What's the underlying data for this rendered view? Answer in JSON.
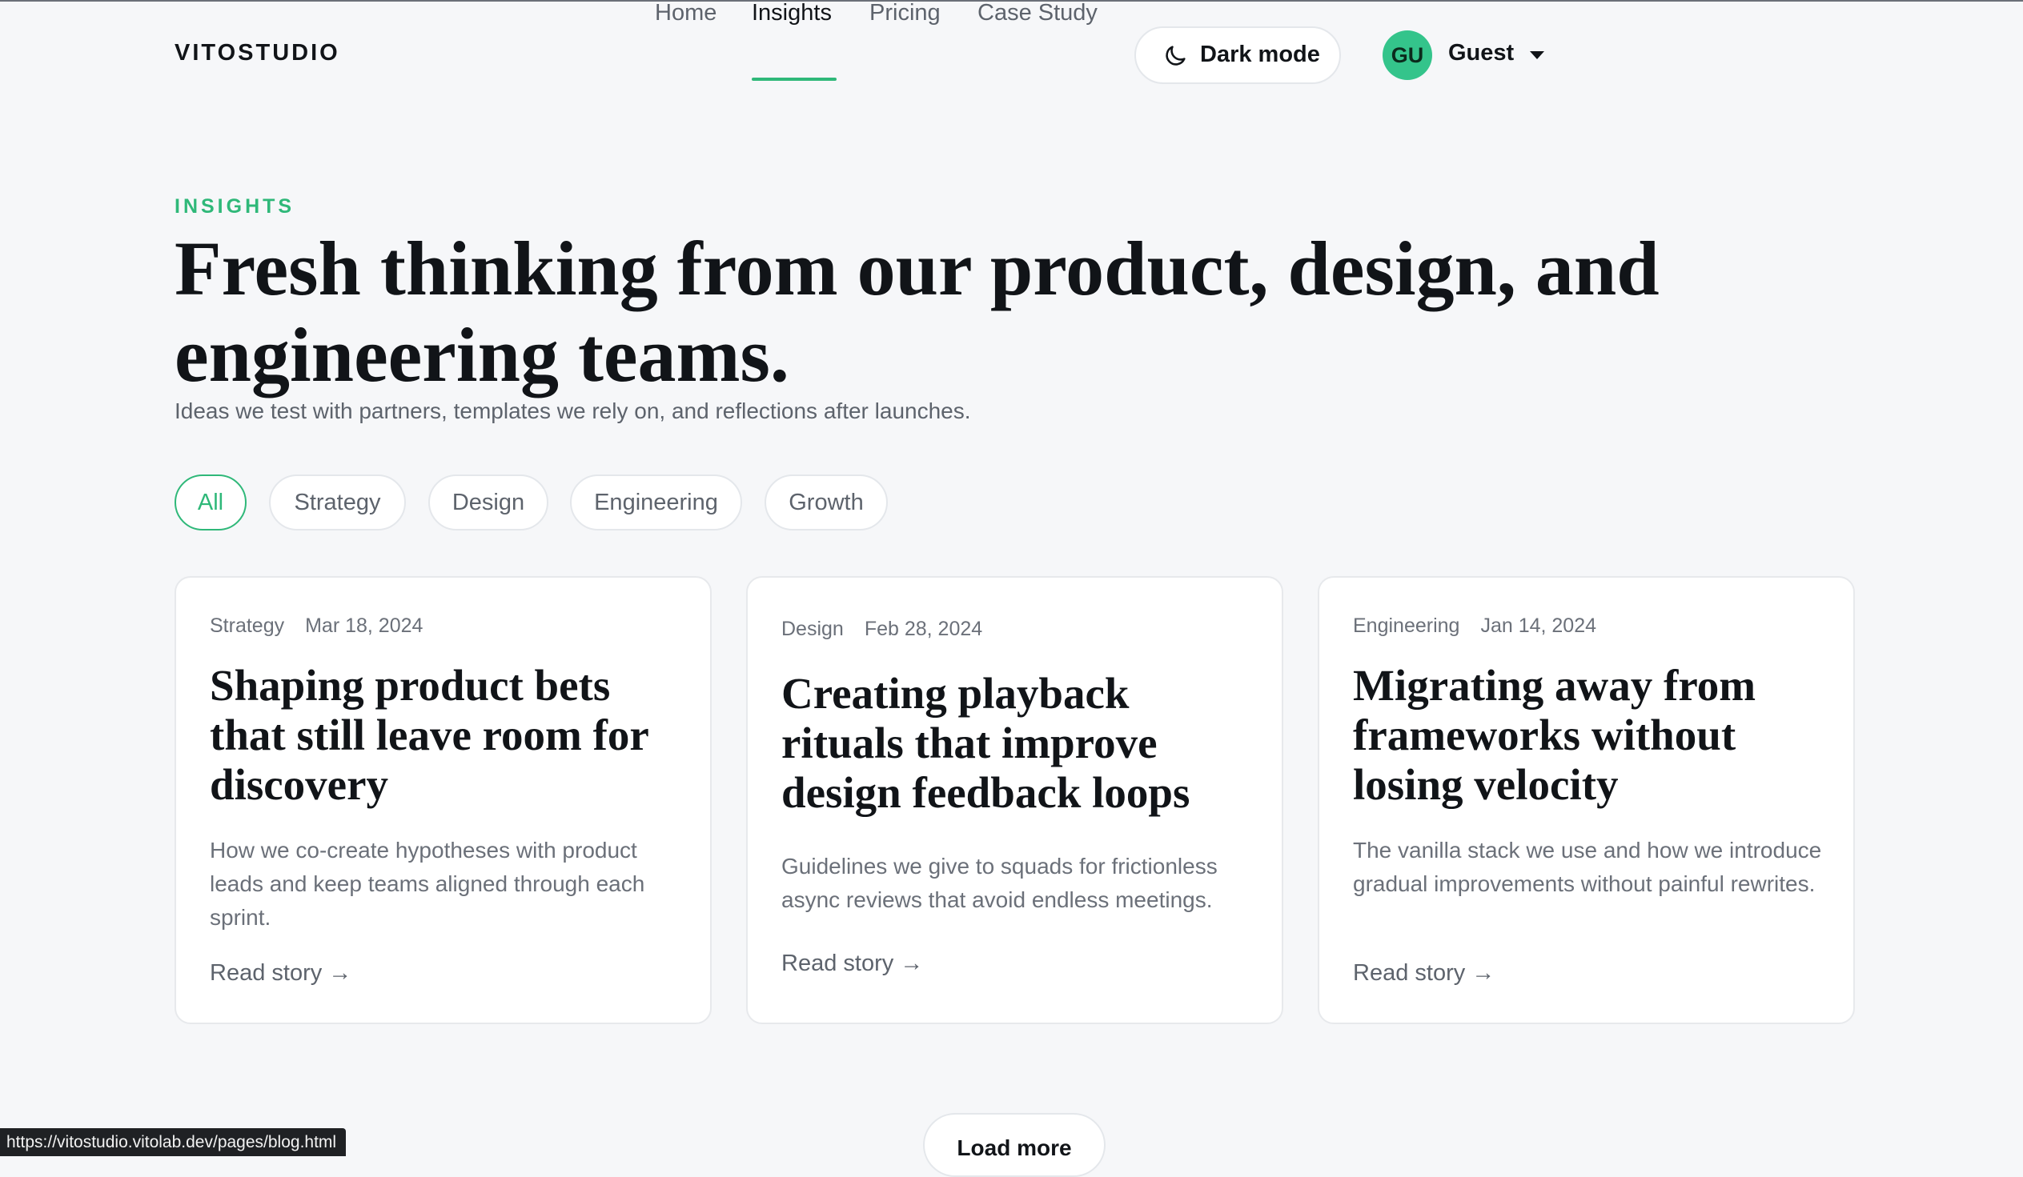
{
  "brand": "VITOSTUDIO",
  "nav": {
    "items": [
      "Home",
      "Insights",
      "Pricing",
      "Case Study"
    ],
    "active": "Insights",
    "dark_mode_label": "Dark mode"
  },
  "user": {
    "initials": "GU",
    "name": "Guest"
  },
  "hero": {
    "eyebrow": "INSIGHTS",
    "title": "Fresh thinking from our product, design, and engineering teams.",
    "subtitle": "Ideas we test with partners, templates we rely on, and reflections after launches."
  },
  "filters": {
    "items": [
      "All",
      "Strategy",
      "Design",
      "Engineering",
      "Growth"
    ],
    "active": "All"
  },
  "posts": [
    {
      "category": "Strategy",
      "date": "Mar 18, 2024",
      "title": "Shaping product bets that still leave room for discovery",
      "excerpt": "How we co-create hypotheses with product leads and keep teams aligned through each sprint.",
      "cta": "Read story →"
    },
    {
      "category": "Design",
      "date": "Feb 28, 2024",
      "title": "Creating playback rituals that improve design feedback loops",
      "excerpt": "Guidelines we give to squads for frictionless async reviews that avoid endless meetings.",
      "cta": "Read story →"
    },
    {
      "category": "Engineering",
      "date": "Jan 14, 2024",
      "title": "Migrating away from frameworks without losing velocity",
      "excerpt": "The vanilla stack we use and how we introduce gradual improvements without painful rewrites.",
      "cta": "Read story →"
    }
  ],
  "load_more_label": "Load more",
  "status_url": "https://vitostudio.vitolab.dev/pages/blog.html",
  "colors": {
    "accent": "#2fb879",
    "avatar": "#34c48b",
    "background": "#f6f7f9"
  },
  "icons": {
    "dark_mode": "moon-icon",
    "user_menu": "chevron-down-icon"
  }
}
